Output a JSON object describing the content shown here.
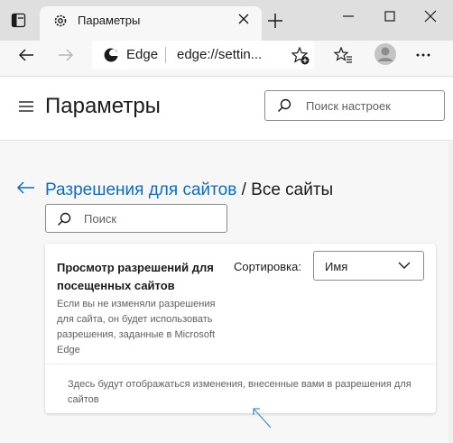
{
  "tab": {
    "title": "Параметры"
  },
  "address": {
    "site": "Edge",
    "url": "edge://settin..."
  },
  "header": {
    "title": "Параметры",
    "search_placeholder": "Поиск настроек"
  },
  "breadcrumb": {
    "parent": "Разрешения для сайтов",
    "separator": " / ",
    "current": "Все сайты"
  },
  "site_search": {
    "placeholder": "Поиск"
  },
  "card": {
    "title": "Просмотр разрешений для посещенных сайтов",
    "description": "Если вы не изменяли разрешения для сайта, он будет использовать разрешения, заданные в Microsoft Edge",
    "sort_label": "Сортировка:",
    "sort_value": "Имя",
    "empty_message": "Здесь будут отображаться изменения, внесенные вами в разрешения для сайтов"
  },
  "colors": {
    "accent": "#0f6cbd",
    "titlebar": "#dfdfdf",
    "annotation_arrow": "#4a90c8"
  }
}
